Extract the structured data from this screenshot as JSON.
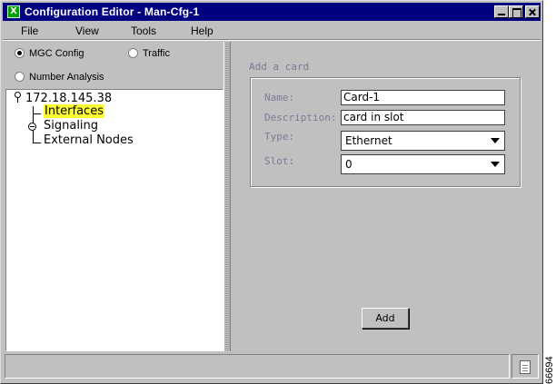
{
  "window": {
    "title": "Configuration Editor - Man-Cfg-1",
    "app_icon_letter": "X"
  },
  "menu": [
    "File",
    "View",
    "Tools",
    "Help"
  ],
  "mode_options": {
    "mgc_config": {
      "label": "MGC Config",
      "selected": true
    },
    "traffic": {
      "label": "Traffic",
      "selected": false
    },
    "number_analysis": {
      "label": "Number Analysis",
      "selected": false
    }
  },
  "tree": {
    "root": "172.18.145.38",
    "nodes": [
      {
        "label": "Interfaces",
        "highlighted": true
      },
      {
        "label": "Signaling",
        "expandable": true
      },
      {
        "label": "External Nodes"
      }
    ]
  },
  "form": {
    "group_title": "Add a card",
    "name_label": "Name:",
    "name_value": "Card-1",
    "description_label": "Description:",
    "description_value": "card in slot",
    "type_label": "Type:",
    "type_value": "Ethernet",
    "slot_label": "Slot:",
    "slot_value": "0",
    "add_button": "Add"
  },
  "status": {
    "text": "",
    "icon": "document-icon"
  },
  "figure_id": "66694",
  "colors": {
    "titlebar": "#000080",
    "highlight": "#ffff33",
    "disabled_label": "#7b7b98",
    "face": "#c0c0c0"
  }
}
